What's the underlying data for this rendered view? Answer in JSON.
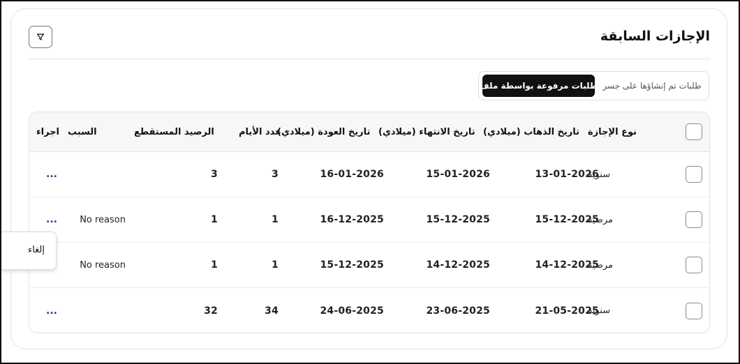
{
  "page": {
    "title": "الإجازات السابقة"
  },
  "tabs": {
    "active": "طلبات مرفوعة بواسطة ملف",
    "other": "طلبات تم إنشاؤها على جسر"
  },
  "table": {
    "headers": {
      "type": "نوع الإجازة",
      "start": "تاريخ الذهاب (ميلادي)",
      "end": "تاريخ الانتهاء (ميلادي)",
      "return": "تاريخ العودة (ميلادي)",
      "days": "عدد الأيام",
      "balance": "الرصيد المستقطع",
      "reason": "السبب",
      "action": "اجراء"
    },
    "rows": [
      {
        "type": "سنوية",
        "start": "13-01-2026",
        "end": "15-01-2026",
        "return": "16-01-2026",
        "days": "3",
        "balance": "3",
        "reason": "",
        "action": "..."
      },
      {
        "type": "مرضية",
        "start": "15-12-2025",
        "end": "15-12-2025",
        "return": "16-12-2025",
        "days": "1",
        "balance": "1",
        "reason": "No reason",
        "action": "..."
      },
      {
        "type": "مرضية",
        "start": "14-12-2025",
        "end": "14-12-2025",
        "return": "15-12-2025",
        "days": "1",
        "balance": "1",
        "reason": "No reason",
        "action": ""
      },
      {
        "type": "سنوية",
        "start": "21-05-2025",
        "end": "23-06-2025",
        "return": "24-06-2025",
        "days": "34",
        "balance": "32",
        "reason": "",
        "action": "..."
      }
    ]
  },
  "popup": {
    "cancel": "إلغاء"
  },
  "icons": {
    "filter": "filter-icon",
    "more": "more-options-icon"
  }
}
